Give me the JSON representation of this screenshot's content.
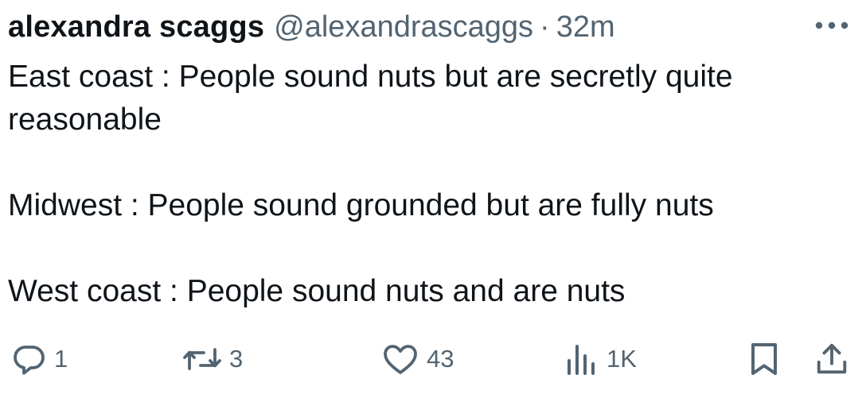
{
  "tweet": {
    "author_name": "alexandra scaggs",
    "handle": "@alexandrascaggs",
    "separator": "·",
    "time_ago": "32m",
    "more_icon": "more-horizontal-icon",
    "text_lines": [
      "East coast : People sound nuts but are secretly quite",
      "reasonable",
      "Midwest : People sound grounded but are fully nuts",
      "West coast : People sound nuts and are nuts"
    ]
  },
  "actions": {
    "reply": {
      "icon": "reply-icon",
      "count": "1"
    },
    "retweet": {
      "icon": "retweet-icon",
      "count": "3"
    },
    "like": {
      "icon": "heart-icon",
      "count": "43"
    },
    "views": {
      "icon": "views-icon",
      "count": "1K"
    },
    "bookmark": {
      "icon": "bookmark-icon"
    },
    "share": {
      "icon": "share-icon"
    }
  },
  "colors": {
    "text_primary": "#0f1419",
    "text_secondary": "#536471",
    "background": "#ffffff"
  }
}
